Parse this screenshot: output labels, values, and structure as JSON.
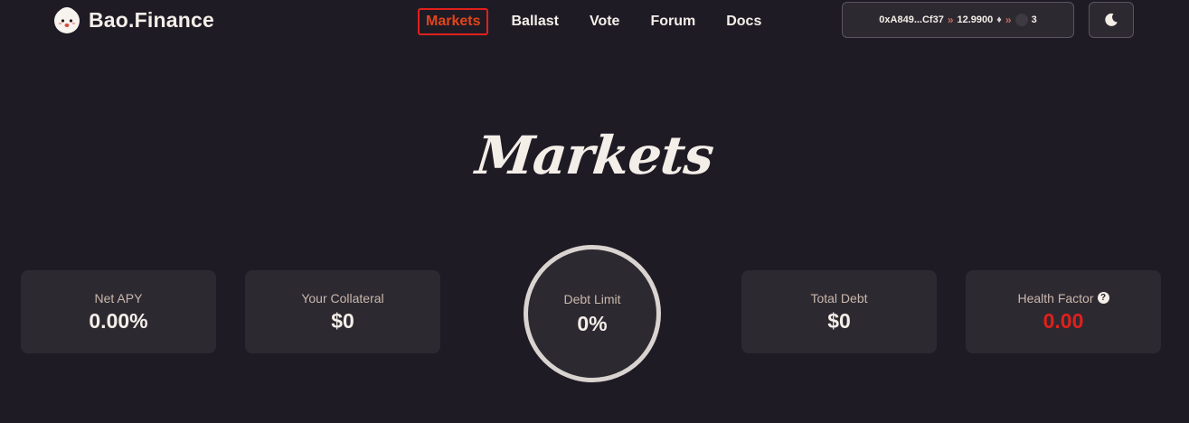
{
  "header": {
    "brand_name": "Bao.Finance",
    "nav": [
      {
        "label": "Markets",
        "active": true
      },
      {
        "label": "Ballast",
        "active": false
      },
      {
        "label": "Vote",
        "active": false
      },
      {
        "label": "Forum",
        "active": false
      },
      {
        "label": "Docs",
        "active": false
      }
    ],
    "wallet": {
      "address": "0xA849...Cf37",
      "eth_balance": "12.9900",
      "eth_icon": "eth-icon",
      "pending_count": "3"
    },
    "theme_toggle_icon": "moon-icon"
  },
  "page_title": "Markets",
  "stats": {
    "net_apy": {
      "label": "Net APY",
      "value": "0.00%"
    },
    "collateral": {
      "label": "Your Collateral",
      "value": "$0"
    },
    "debt_limit": {
      "label": "Debt Limit",
      "value": "0%"
    },
    "total_debt": {
      "label": "Total Debt",
      "value": "$0"
    },
    "health_factor": {
      "label": "Health Factor",
      "value": "0.00",
      "help_icon": "question-icon"
    }
  },
  "colors": {
    "background": "#1f1b25",
    "card": "#2d2931",
    "accent": "#e0461c",
    "danger": "#e0201c",
    "text": "#f4eee8",
    "muted": "#c9b7ac"
  }
}
